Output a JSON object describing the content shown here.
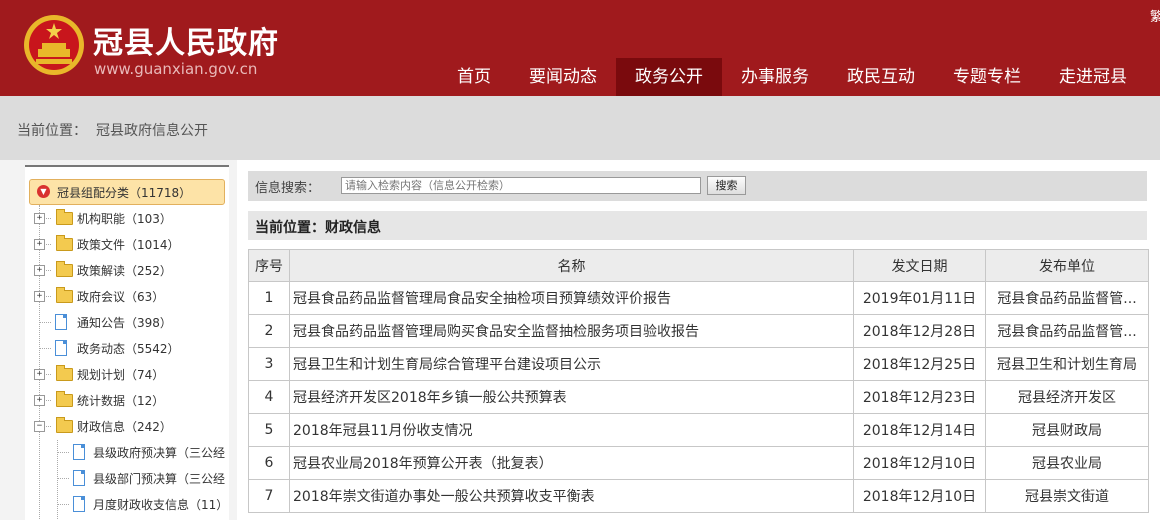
{
  "header": {
    "site_name": "冠县人民政府",
    "site_url": "www.guanxian.gov.cn",
    "corner_text": "繁"
  },
  "nav": {
    "items": [
      {
        "label": "首页",
        "active": false
      },
      {
        "label": "要闻动态",
        "active": false
      },
      {
        "label": "政务公开",
        "active": true
      },
      {
        "label": "办事服务",
        "active": false
      },
      {
        "label": "政民互动",
        "active": false
      },
      {
        "label": "专题专栏",
        "active": false
      },
      {
        "label": "走进冠县",
        "active": false
      }
    ]
  },
  "breadcrumb": {
    "label": "当前位置：",
    "value": "冠县政府信息公开"
  },
  "sidebar": {
    "root_label": "冠县组配分类（11718）",
    "items": [
      {
        "label": "机构职能（103）",
        "type": "folder"
      },
      {
        "label": "政策文件（1014）",
        "type": "folder"
      },
      {
        "label": "政策解读（252）",
        "type": "folder"
      },
      {
        "label": "政府会议（63）",
        "type": "folder"
      },
      {
        "label": "通知公告（398）",
        "type": "doc"
      },
      {
        "label": "政务动态（5542）",
        "type": "doc"
      },
      {
        "label": "规划计划（74）",
        "type": "folder"
      },
      {
        "label": "统计数据（12）",
        "type": "folder"
      },
      {
        "label": "财政信息（242）",
        "type": "folder-open"
      },
      {
        "label": "县级政府预决算（三公经",
        "type": "doc-child"
      },
      {
        "label": "县级部门预决算（三公经",
        "type": "doc-child"
      },
      {
        "label": "月度财政收支信息（11）",
        "type": "doc-child"
      }
    ]
  },
  "search": {
    "label": "信息搜索：",
    "placeholder": "请输入检索内容（信息公开检索）",
    "button_label": "搜索"
  },
  "section": {
    "title": "当前位置：财政信息"
  },
  "table": {
    "headers": [
      "序号",
      "名称",
      "发文日期",
      "发布单位"
    ],
    "rows": [
      {
        "seq": "1",
        "name": "冠县食品药品监督管理局食品安全抽检项目预算绩效评价报告",
        "date": "2019年01月11日",
        "unit": "冠县食品药品监督管..."
      },
      {
        "seq": "2",
        "name": "冠县食品药品监督管理局购买食品安全监督抽检服务项目验收报告",
        "date": "2018年12月28日",
        "unit": "冠县食品药品监督管..."
      },
      {
        "seq": "3",
        "name": "冠县卫生和计划生育局综合管理平台建设项目公示",
        "date": "2018年12月25日",
        "unit": "冠县卫生和计划生育局"
      },
      {
        "seq": "4",
        "name": "冠县经济开发区2018年乡镇一般公共预算表",
        "date": "2018年12月23日",
        "unit": "冠县经济开发区"
      },
      {
        "seq": "5",
        "name": "2018年冠县11月份收支情况",
        "date": "2018年12月14日",
        "unit": "冠县财政局"
      },
      {
        "seq": "6",
        "name": "冠县农业局2018年预算公开表（批复表）",
        "date": "2018年12月10日",
        "unit": "冠县农业局"
      },
      {
        "seq": "7",
        "name": "2018年崇文街道办事处一般公共预算收支平衡表",
        "date": "2018年12月10日",
        "unit": "冠县崇文街道"
      }
    ]
  },
  "colors": {
    "header_bg": "#a01a1d",
    "nav_active_bg": "#7a0a0d",
    "crumb_bg": "#dcdcdc",
    "root_bg": "#fde3a7"
  }
}
